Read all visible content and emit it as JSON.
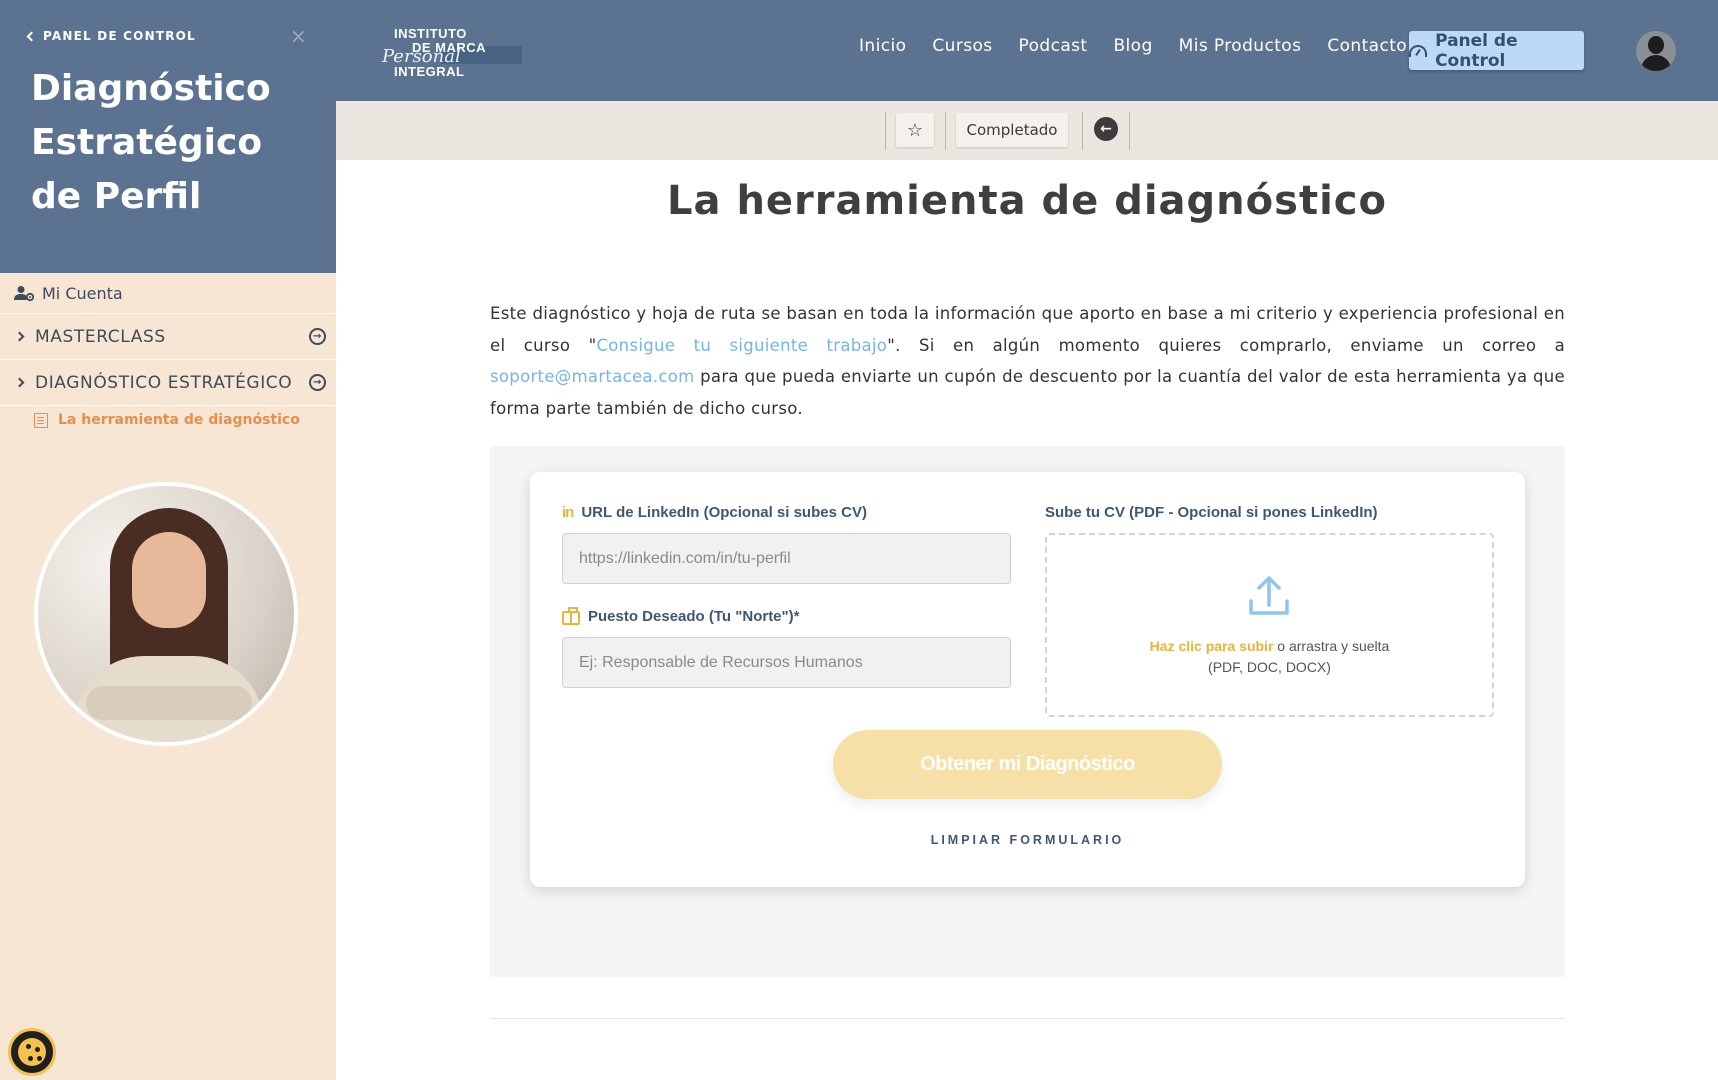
{
  "sidebar": {
    "back_label": "PANEL DE CONTROL",
    "close_glyph": "×",
    "course_title": "Diagnóstico Estratégico de Perfil",
    "account_label": "Mi Cuenta",
    "sections": [
      {
        "label": "MASTERCLASS"
      },
      {
        "label": "DIAGNÓSTICO ESTRATÉGICO"
      }
    ],
    "active_lesson": "La herramienta de diagnóstico",
    "header_color": "#5b7290",
    "background_color": "#f7e6d3",
    "active_color": "#e58f4a"
  },
  "topnav": {
    "logo": {
      "line1": "INSTITUTO",
      "line2": "DE MARCA",
      "script": "Personal",
      "line3": "INTEGRAL"
    },
    "links": [
      "Inicio",
      "Cursos",
      "Podcast",
      "Blog",
      "Mis Productos",
      "Contacto"
    ],
    "panel_button": "Panel de Control",
    "panel_button_color": "#bcdaf5"
  },
  "lesson_bar": {
    "complete_label": "Completado",
    "star_glyph": "☆",
    "back_glyph": "←"
  },
  "main": {
    "title": "La herramienta de diagnóstico",
    "intro": {
      "part1": "Este diagnóstico y hoja de ruta se basan en toda la información que aporto en base a mi criterio y experiencia profesional en el curso \"",
      "course_link": "Consigue tu siguiente trabajo",
      "part2": "\". Si en algún momento quieres comprarlo, enviame un correo a ",
      "email_link": "soporte@martacea.com",
      "part3": " para que pueda enviarte un cupón de descuento por la cuantía del valor de esta herramienta ya que forma parte también de dicho curso."
    }
  },
  "form": {
    "linkedin_label": "URL de LinkedIn (Opcional si subes CV)",
    "linkedin_icon_glyph": "in",
    "linkedin_placeholder": "https://linkedin.com/in/tu-perfil",
    "linkedin_value": "",
    "puesto_label": "Puesto Deseado (Tu \"Norte\")*",
    "puesto_placeholder": "Ej: Responsable de Recursos Humanos",
    "puesto_value": "",
    "cv_label": "Sube tu CV (PDF - Opcional si pones LinkedIn)",
    "upload_highlight": "Haz clic para subir",
    "upload_rest": " o arrastra y suelta",
    "upload_formats": "(PDF, DOC, DOCX)",
    "submit_label": "Obtener mi Diagnóstico",
    "clear_label": "LIMPIAR FORMULARIO",
    "accent_color": "#e8b43c",
    "label_color": "#3f5774",
    "upload_icon_color": "#8ec5ee"
  }
}
